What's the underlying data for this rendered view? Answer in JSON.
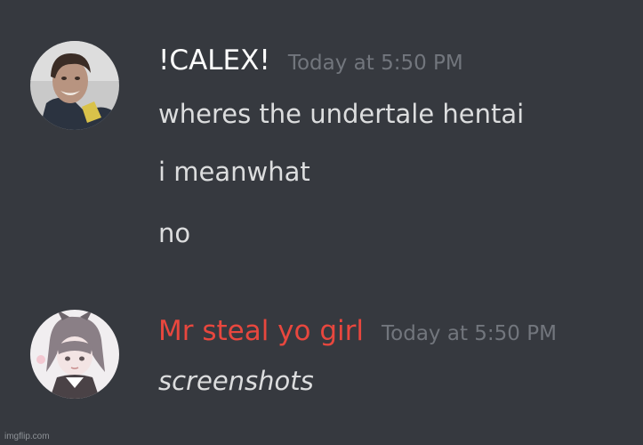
{
  "messages": [
    {
      "author": "!CALEX!",
      "author_color": "#ffffff",
      "timestamp": "Today at 5:50 PM",
      "avatar": "user-avatar-photo",
      "lines": [
        "wheres the undertale hentai",
        "i meanwhat",
        "no"
      ]
    },
    {
      "author": "Mr steal yo girl",
      "author_color": "#e8473e",
      "timestamp": "Today at 5:50 PM",
      "avatar": "anime-avatar",
      "lines": [
        "screenshots"
      ]
    }
  ],
  "watermark": "imgflip.com"
}
